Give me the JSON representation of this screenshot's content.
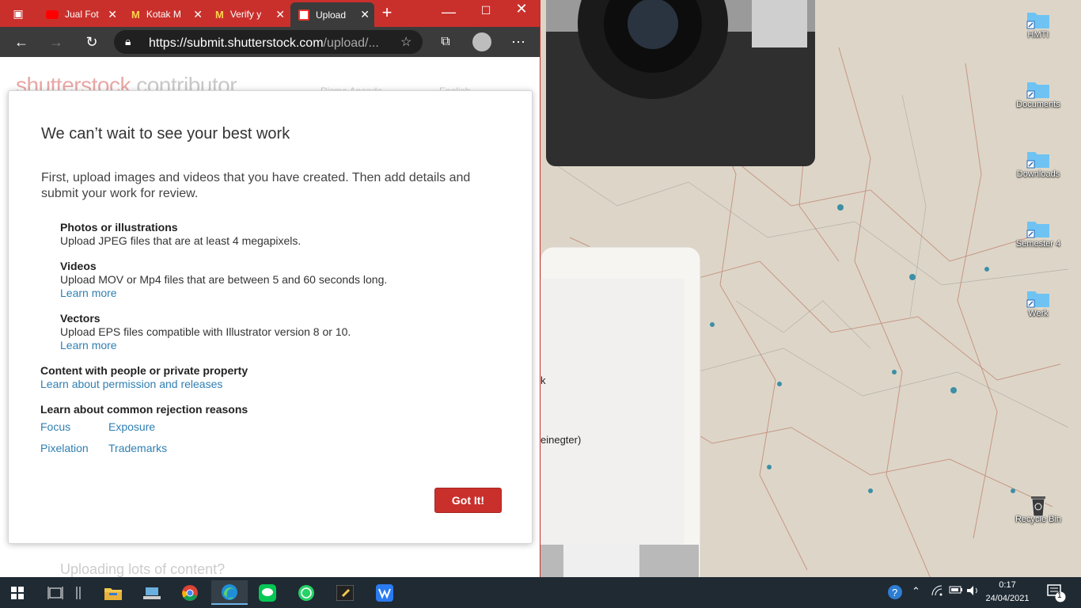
{
  "browser": {
    "tabs": [
      {
        "label": "Jual Fot",
        "icon": "youtube-icon"
      },
      {
        "label": "Kotak M",
        "icon": "gmail-icon"
      },
      {
        "label": "Verify y",
        "icon": "gmail-icon"
      },
      {
        "label": "Upload",
        "icon": "shutterstock-icon",
        "active": true
      }
    ],
    "new_tab": "+",
    "url_host": "https://submit.shutterstock.com",
    "url_path": "/upload/..."
  },
  "page": {
    "logo_brand": "shutterstock",
    "logo_suffix": "contributor",
    "user": "Risma Ananda",
    "language": "English",
    "footer_text": "Uploading lots of content?"
  },
  "modal": {
    "title": "We can’t wait to see your best work",
    "intro": "First, upload images and videos that you have created. Then add details and submit your work for review.",
    "photos": {
      "head": "Photos or illustrations",
      "body": "Upload JPEG files that are at least 4 megapixels."
    },
    "videos": {
      "head": "Videos",
      "body": "Upload MOV or Mp4 files that are between 5 and 60 seconds long.",
      "link": "Learn more"
    },
    "vectors": {
      "head": "Vectors",
      "body": "Upload EPS files compatible with Illustrator version 8 or 10.",
      "link": "Learn more"
    },
    "people": {
      "head": "Content with people or private property",
      "link": "Learn about permission and releases"
    },
    "rejection": {
      "head": "Learn about common rejection reasons",
      "links": [
        "Focus",
        "Exposure",
        "Pixelation",
        "Trademarks"
      ]
    },
    "button": "Got It!"
  },
  "desktop": {
    "icons": [
      "HMTI",
      "Documents",
      "Downloads",
      "Semester 4",
      "Werk",
      "Recycle Bin"
    ],
    "bg_window_text1": "k",
    "bg_window_text2": "einegter)"
  },
  "taskbar": {
    "time": "0:17",
    "date": "24/04/2021",
    "notification_count": "1"
  },
  "colors": {
    "brand_red": "#c9302c",
    "link_blue": "#2f7fb3"
  }
}
